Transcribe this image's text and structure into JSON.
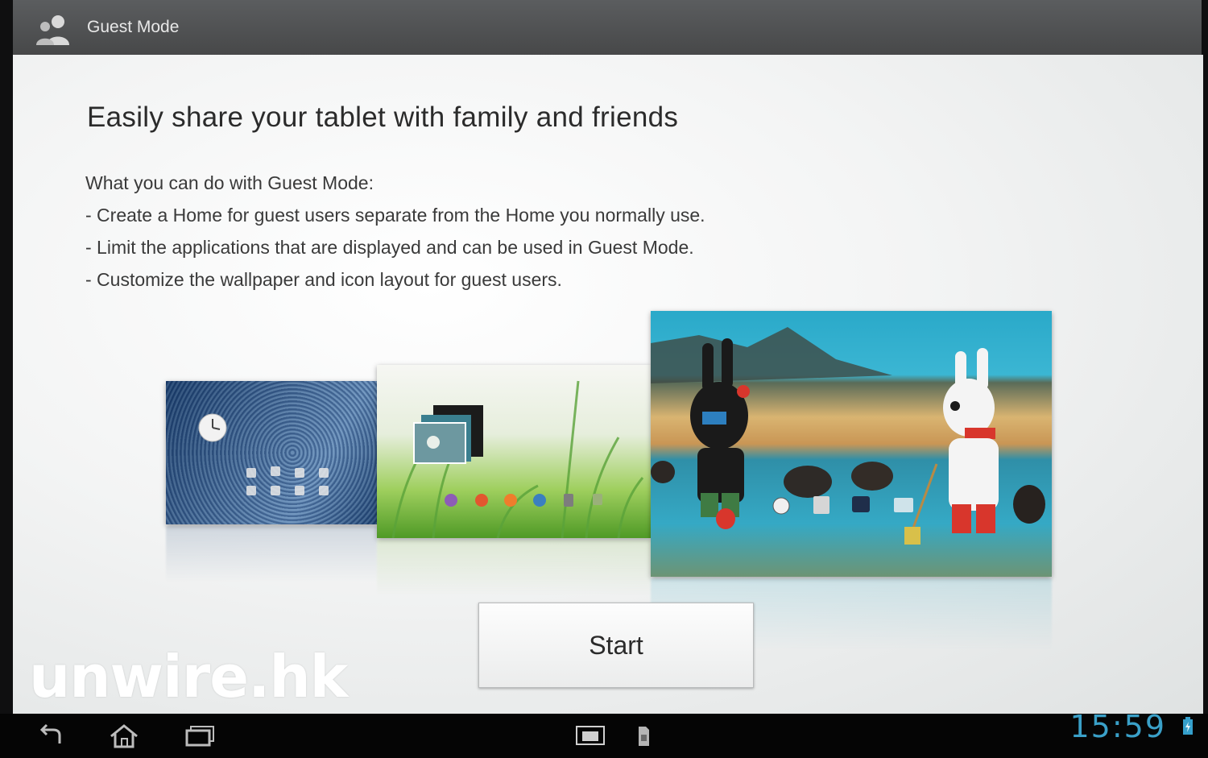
{
  "action_bar": {
    "title": "Guest Mode",
    "icon": "guest-users-icon"
  },
  "main": {
    "headline": "Easily share your tablet with family and friends",
    "lead": "What you can do with Guest Mode:",
    "bullets": [
      "- Create a Home for guest users separate from the Home you normally use.",
      "- Limit the applications that are displayed and can be used in Guest Mode.",
      "- Customize the wallpaper and icon layout for guest users."
    ],
    "start_label": "Start"
  },
  "watermark": "unwire.hk",
  "system_bar": {
    "clock": "15:59",
    "icons": [
      "back-icon",
      "home-icon",
      "recent-apps-icon",
      "screenshot-icon",
      "sd-card-icon",
      "battery-icon"
    ]
  },
  "colors": {
    "clock": "#3aa0c8",
    "action_bar": "#505253",
    "nav_bar": "#050505"
  }
}
